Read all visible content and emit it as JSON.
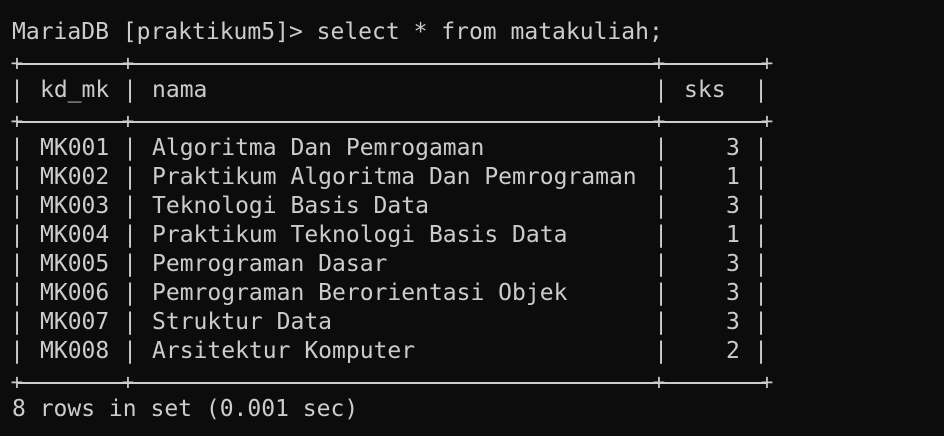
{
  "prompt": {
    "text": "MariaDB [praktikum5]> select * from matakuliah;"
  },
  "table": {
    "columns": [
      "kd_mk",
      "nama",
      "sks"
    ],
    "rows": [
      {
        "kd_mk": "MK001",
        "nama": "Algoritma Dan Pemrogaman",
        "sks": "3"
      },
      {
        "kd_mk": "MK002",
        "nama": "Praktikum Algoritma Dan Pemrograman",
        "sks": "1"
      },
      {
        "kd_mk": "MK003",
        "nama": "Teknologi Basis Data",
        "sks": "3"
      },
      {
        "kd_mk": "MK004",
        "nama": "Praktikum Teknologi Basis Data",
        "sks": "1"
      },
      {
        "kd_mk": "MK005",
        "nama": "Pemrograman Dasar",
        "sks": "3"
      },
      {
        "kd_mk": "MK006",
        "nama": "Pemrograman Berorientasi Objek",
        "sks": "3"
      },
      {
        "kd_mk": "MK007",
        "nama": "Struktur Data",
        "sks": "3"
      },
      {
        "kd_mk": "MK008",
        "nama": "Arsitektur Komputer",
        "sks": "2"
      }
    ]
  },
  "result": {
    "text": "8 rows in set (0.001 sec)"
  },
  "colors": {
    "background": "#0c0c0c",
    "foreground": "#cccccc"
  }
}
